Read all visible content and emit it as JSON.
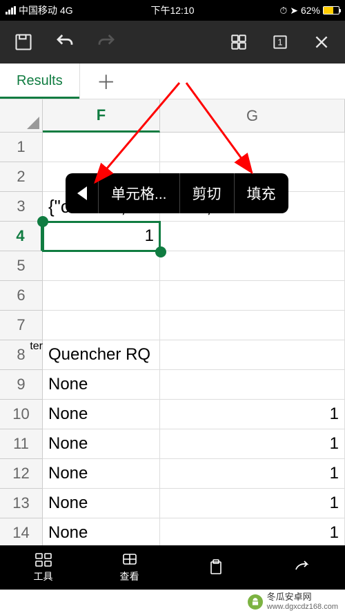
{
  "status": {
    "carrier": "中国移动",
    "network": "4G",
    "time": "下午12:10",
    "battery_pct": "62%"
  },
  "tabs": {
    "active": "Results",
    "add_symbol": "＋"
  },
  "columns": {
    "f": "F",
    "g": "G"
  },
  "rows": [
    "1",
    "2",
    "3",
    "4",
    "5",
    "6",
    "7",
    "8",
    "9",
    "10",
    "11",
    "12",
    "13",
    "14"
  ],
  "cells": {
    "f3": "{\"code\":0,\"data\":null,\"",
    "f4": "1",
    "e8": "ter",
    "f8": "Quencher RQ",
    "f9": "None",
    "f10": "None",
    "f11": "None",
    "f12": "None",
    "f13": "None",
    "f14": "None",
    "g10": "1",
    "g11": "1",
    "g12": "1",
    "g13": "1",
    "g14": "1"
  },
  "selected_cell": "F4",
  "context_menu": {
    "items": [
      "单元格...",
      "剪切",
      "填充"
    ]
  },
  "bottom": {
    "tools": "工具",
    "view": "查看"
  },
  "watermark": {
    "title": "冬瓜安卓网",
    "url": "www.dgxcdz168.com"
  }
}
